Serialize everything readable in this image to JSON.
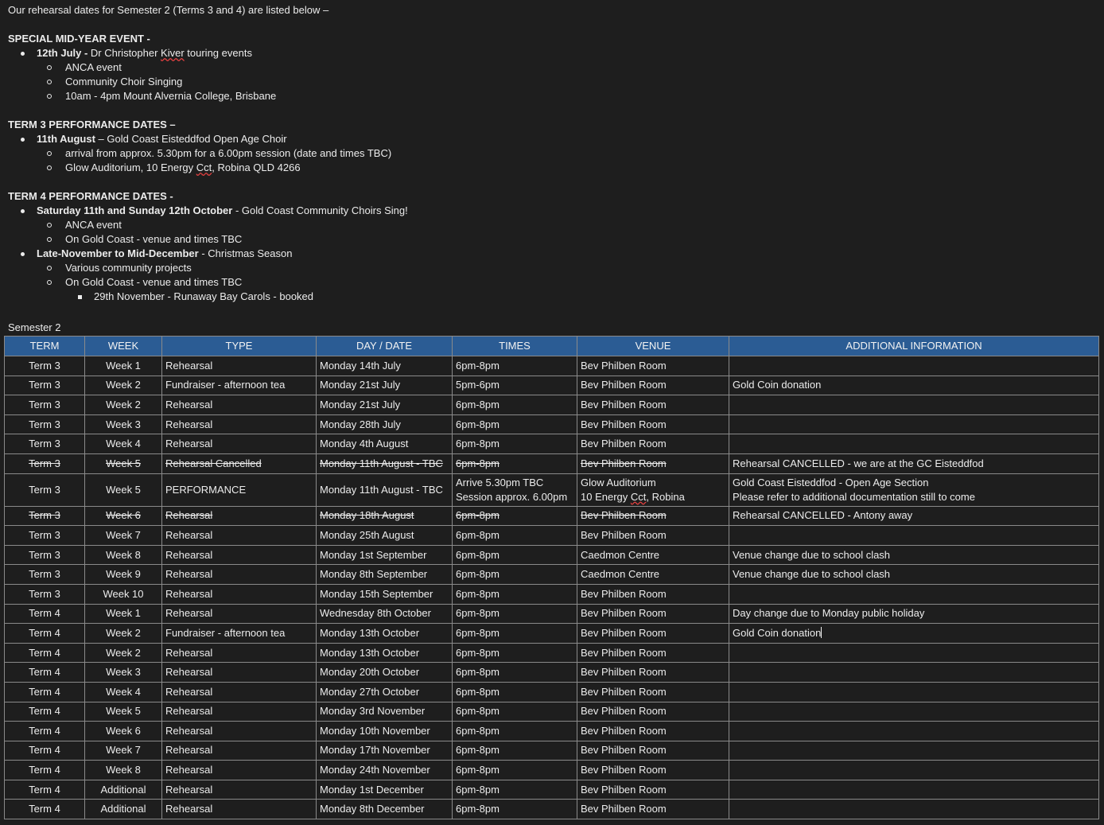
{
  "intro": "Our rehearsal dates for Semester 2 (Terms 3 and 4) are listed below –",
  "special": {
    "heading": "SPECIAL MID-YEAR EVENT -",
    "item_bold": "12th July -",
    "item_text_1": " Dr Christopher ",
    "item_text_spell": "Kiver",
    "item_text_2": " touring events",
    "subs": [
      "ANCA event",
      "Community Choir Singing",
      "10am - 4pm Mount Alvernia College, Brisbane"
    ]
  },
  "term3": {
    "heading": "TERM 3 PERFORMANCE DATES –",
    "item_bold": "11th August",
    "item_text": " – Gold Coast Eisteddfod Open Age Choir",
    "sub1": "arrival from approx. 5.30pm for a 6.00pm session (date and times TBC)",
    "sub2_a": "Glow Auditorium, 10 Energy ",
    "sub2_spell": "Cct",
    "sub2_b": ", Robina QLD 4266"
  },
  "term4": {
    "heading": "TERM 4 PERFORMANCE DATES -",
    "item1_bold": "Saturday 11th and Sunday 12th October",
    "item1_text": " - Gold Coast Community Choirs Sing!",
    "item1_subs": [
      "ANCA event",
      "On Gold Coast - venue and times TBC"
    ],
    "item2_bold": "Late-November to Mid-December",
    "item2_text": " - Christmas Season",
    "item2_subs": [
      "Various community projects",
      "On Gold Coast - venue and times TBC"
    ],
    "item2_subsub": "29th November - Runaway Bay Carols - booked"
  },
  "semester_label": "Semester 2",
  "table": {
    "headers": [
      "TERM",
      "WEEK",
      "TYPE",
      "DAY / DATE",
      "TIMES",
      "VENUE",
      "ADDITIONAL INFORMATION"
    ],
    "rows": [
      {
        "term": "Term 3",
        "week": "Week 1",
        "type": "Rehearsal",
        "date": "Monday 14th July",
        "times": "6pm-8pm",
        "venue": "Bev Philben Room",
        "info": ""
      },
      {
        "term": "Term 3",
        "week": "Week 2",
        "type": "Fundraiser - afternoon tea",
        "date": "Monday 21st July",
        "times": "5pm-6pm",
        "venue": "Bev Philben Room",
        "info": "Gold Coin donation"
      },
      {
        "term": "Term 3",
        "week": "Week 2",
        "type": "Rehearsal",
        "date": "Monday 21st July",
        "times": "6pm-8pm",
        "venue": "Bev Philben Room",
        "info": ""
      },
      {
        "term": "Term 3",
        "week": "Week 3",
        "type": "Rehearsal",
        "date": "Monday 28th July",
        "times": "6pm-8pm",
        "venue": "Bev Philben Room",
        "info": ""
      },
      {
        "term": "Term 3",
        "week": "Week 4",
        "type": "Rehearsal",
        "date": "Monday 4th August",
        "times": "6pm-8pm",
        "venue": "Bev Philben Room",
        "info": ""
      },
      {
        "term": "Term 3",
        "week": "Week 5",
        "type": "Rehearsal Cancelled",
        "date": "Monday 11th August - TBC",
        "times": "6pm-8pm",
        "venue": "Bev Philben Room",
        "info": "Rehearsal CANCELLED - we are at the GC Eisteddfod"
      },
      {
        "term": "Term 3",
        "week": "Week 5",
        "type": "PERFORMANCE",
        "date": "Monday 11th August - TBC",
        "times": "Arrive 5.30pm TBC",
        "times2": "Session approx. 6.00pm",
        "venue": "Glow Auditorium",
        "venue2a": "10 Energy ",
        "venue2spell": "Cct",
        "venue2b": ", Robina",
        "info": "Gold Coast Eisteddfod - Open Age Section",
        "info2": "Please refer to additional documentation still to come"
      },
      {
        "term": "Term 3",
        "week": "Week 6",
        "type": "Rehearsal",
        "date": "Monday 18th August",
        "times": "6pm-8pm",
        "venue": "Bev Philben Room",
        "info": "Rehearsal CANCELLED - Antony away"
      },
      {
        "term": "Term 3",
        "week": "Week 7",
        "type": "Rehearsal",
        "date": "Monday 25th August",
        "times": "6pm-8pm",
        "venue": "Bev Philben Room",
        "info": ""
      },
      {
        "term": "Term 3",
        "week": "Week 8",
        "type": "Rehearsal",
        "date": "Monday 1st September",
        "times": "6pm-8pm",
        "venue": "Caedmon Centre",
        "info": "Venue change due to school clash"
      },
      {
        "term": "Term 3",
        "week": "Week 9",
        "type": "Rehearsal",
        "date": "Monday 8th September",
        "times": "6pm-8pm",
        "venue": "Caedmon Centre",
        "info": "Venue change due to school clash"
      },
      {
        "term": "Term 3",
        "week": "Week 10",
        "type": "Rehearsal",
        "date": "Monday 15th September",
        "times": "6pm-8pm",
        "venue": "Bev Philben Room",
        "info": ""
      },
      {
        "term": "Term 4",
        "week": "Week 1",
        "type": "Rehearsal",
        "date": "Wednesday 8th October",
        "times": "6pm-8pm",
        "venue": "Bev Philben Room",
        "info": "Day change due to Monday public holiday"
      },
      {
        "term": "Term 4",
        "week": "Week 2",
        "type": "Fundraiser - afternoon tea",
        "date": "Monday 13th October",
        "times": "6pm-8pm",
        "venue": "Bev Philben Room",
        "info": "Gold Coin donation"
      },
      {
        "term": "Term 4",
        "week": "Week 2",
        "type": "Rehearsal",
        "date": "Monday 13th October",
        "times": "6pm-8pm",
        "venue": "Bev Philben Room",
        "info": ""
      },
      {
        "term": "Term 4",
        "week": "Week 3",
        "type": "Rehearsal",
        "date": "Monday 20th October",
        "times": "6pm-8pm",
        "venue": "Bev Philben Room",
        "info": ""
      },
      {
        "term": "Term 4",
        "week": "Week 4",
        "type": "Rehearsal",
        "date": "Monday 27th October",
        "times": "6pm-8pm",
        "venue": "Bev Philben Room",
        "info": ""
      },
      {
        "term": "Term 4",
        "week": "Week 5",
        "type": "Rehearsal",
        "date": "Monday 3rd November",
        "times": "6pm-8pm",
        "venue": "Bev Philben Room",
        "info": ""
      },
      {
        "term": "Term 4",
        "week": "Week 6",
        "type": "Rehearsal",
        "date": "Monday 10th November",
        "times": "6pm-8pm",
        "venue": "Bev Philben Room",
        "info": ""
      },
      {
        "term": "Term 4",
        "week": "Week 7",
        "type": "Rehearsal",
        "date": "Monday 17th November",
        "times": "6pm-8pm",
        "venue": "Bev Philben Room",
        "info": ""
      },
      {
        "term": "Term 4",
        "week": "Week 8",
        "type": "Rehearsal",
        "date": "Monday 24th November",
        "times": "6pm-8pm",
        "venue": "Bev Philben Room",
        "info": ""
      },
      {
        "term": "Term 4",
        "week": "Additional",
        "type": "Rehearsal",
        "date": "Monday 1st December",
        "times": "6pm-8pm",
        "venue": "Bev Philben Room",
        "info": ""
      },
      {
        "term": "Term 4",
        "week": "Additional",
        "type": "Rehearsal",
        "date": "Monday 8th December",
        "times": "6pm-8pm",
        "venue": "Bev Philben Room",
        "info": ""
      }
    ]
  }
}
